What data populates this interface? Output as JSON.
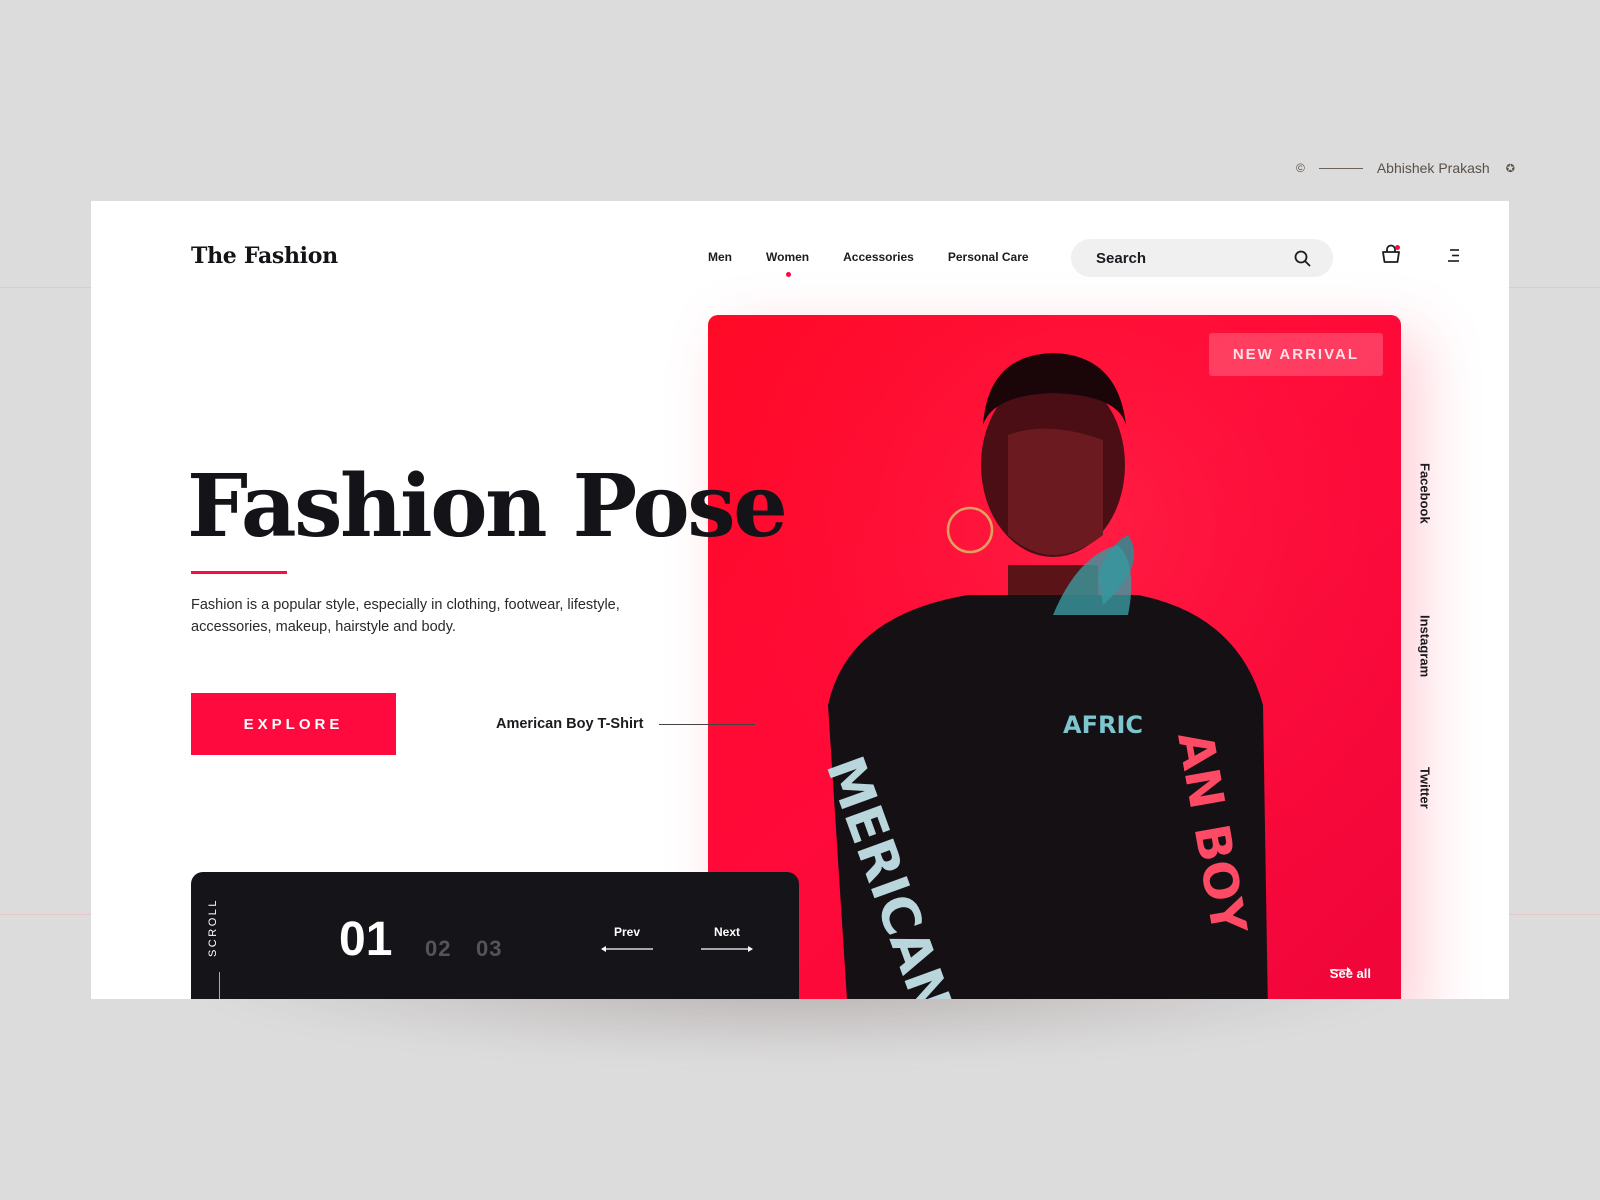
{
  "credit": {
    "copyright_symbol": "©",
    "author": "Abhishek Prakash",
    "badge_symbol": "✪"
  },
  "header": {
    "logo": "The Fashion",
    "nav": [
      {
        "label": "Men",
        "active": false
      },
      {
        "label": "Women",
        "active": true
      },
      {
        "label": "Accessories",
        "active": false
      },
      {
        "label": "Personal Care",
        "active": false
      }
    ],
    "search": {
      "placeholder": "Search",
      "value": "",
      "icon": "search-icon"
    },
    "cart": {
      "icon": "shopping-bag-icon",
      "has_notification": true
    },
    "menu": {
      "icon": "hamburger-menu-icon"
    }
  },
  "hero": {
    "title": "Fashion Pose",
    "description": "Fashion is a popular style, especially in clothing, footwear, lifestyle, accessories, makeup, hairstyle and body.",
    "cta_label": "EXPLORE",
    "product_link": "American Boy T-Shirt"
  },
  "photo": {
    "badge": "NEW ARRIVAL",
    "shirt_text_chest": "AFRIC",
    "shirt_text_sleeve_left": "MERICAN BOY",
    "shirt_text_sleeve_right": "AN BOY",
    "see_all_label": "See all"
  },
  "social": [
    "Facebook",
    "Instagram",
    "Twitter"
  ],
  "slider": {
    "scroll_label": "SCROLL",
    "current": "01",
    "others": [
      "02",
      "03"
    ],
    "prev_label": "Prev",
    "next_label": "Next"
  },
  "colors": {
    "accent": "#ff0a3f",
    "dark": "#151418",
    "background": "#dcdcdc"
  }
}
